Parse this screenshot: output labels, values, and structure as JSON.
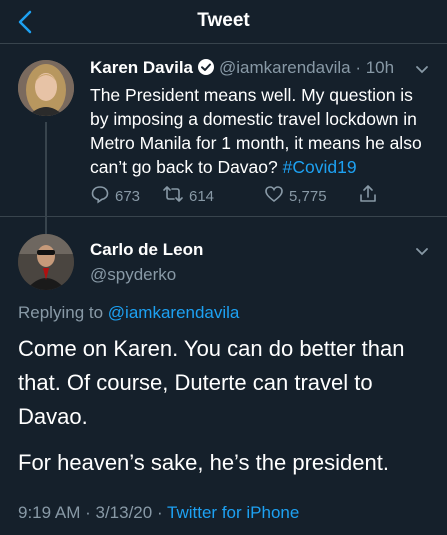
{
  "header": {
    "title": "Tweet"
  },
  "parent_tweet": {
    "name": "Karen Davila",
    "handle": "@iamkarendavila",
    "time": "10h",
    "text": "The President means well. My question is by imposing a domestic travel lockdown in Metro Manila for 1 month, it means he also can’t go back to Davao?",
    "hashtag": "#Covid19",
    "replies": "673",
    "retweets": "614",
    "likes": "5,775"
  },
  "reply_tweet": {
    "name": "Carlo de Leon",
    "handle": "@spyderko",
    "replying_prefix": "Replying to",
    "replying_to": "@iamkarendavila",
    "paragraph1": "Come on Karen. You can do better than that. Of course, Duterte can travel to Davao.",
    "paragraph2": "For heaven’s sake, he’s the president.",
    "time": "9:19 AM",
    "date": "3/13/20",
    "source": "Twitter for iPhone"
  },
  "colors": {
    "background": "#15202b",
    "accent": "#1da1f2",
    "muted": "#8899a6",
    "divider": "#38444d"
  },
  "icons": [
    "back-arrow-icon",
    "verified-badge-icon",
    "chevron-down-icon",
    "reply-icon",
    "retweet-icon",
    "like-icon",
    "share-icon"
  ]
}
